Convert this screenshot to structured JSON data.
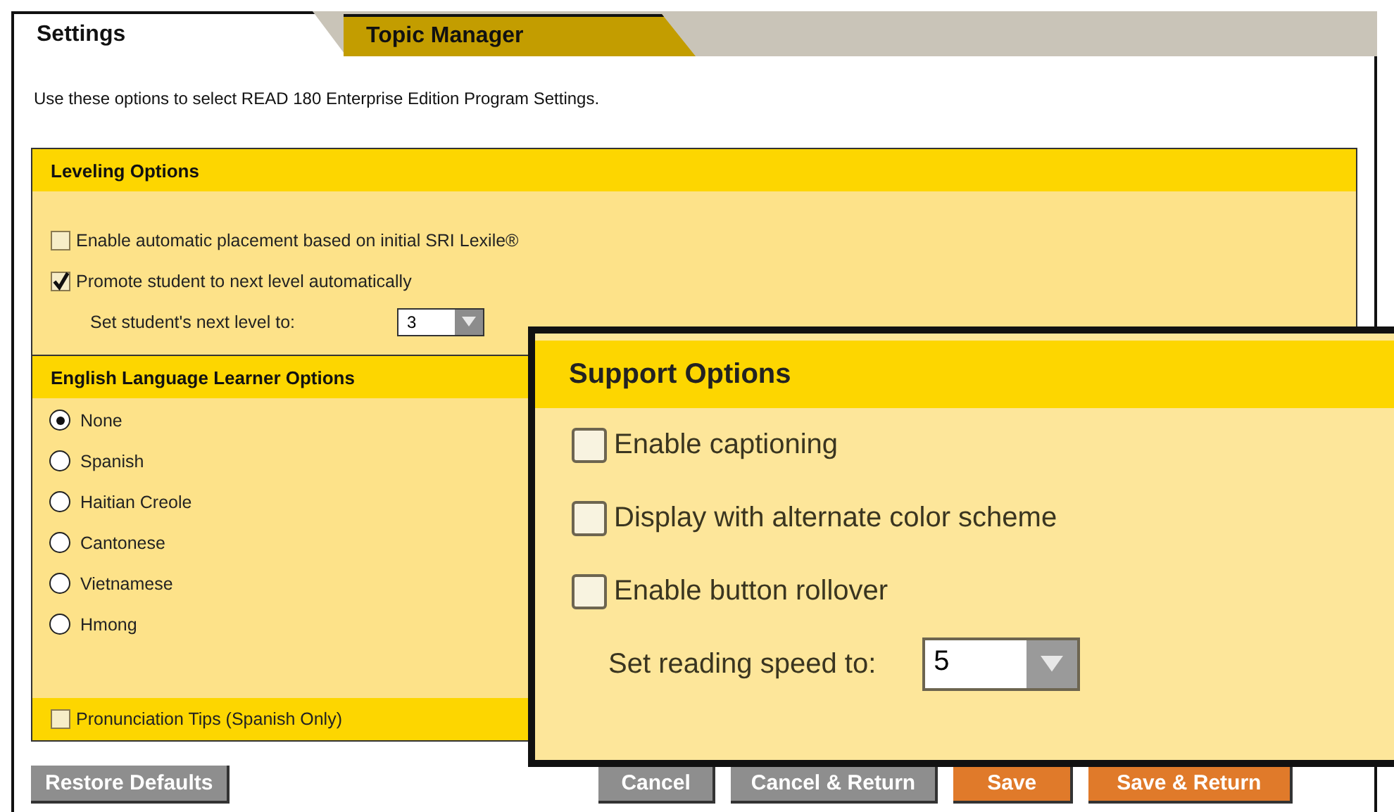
{
  "tabs": [
    {
      "label": "Settings",
      "selected": true
    },
    {
      "label": "Topic Manager",
      "selected": false
    }
  ],
  "description": "Use these options to select READ 180 Enterprise Edition Program Settings.",
  "leveling_options": {
    "title": "Leveling Options",
    "checkboxes": [
      {
        "label": "Enable automatic placement based on initial SRI Lexile®",
        "checked": false
      },
      {
        "label": "Promote student to next level automatically",
        "checked": true
      }
    ],
    "next_level": {
      "label": "Set student's next level to:",
      "value": "3"
    }
  },
  "ell_options": {
    "title": "English Language Learner Options",
    "languages": [
      {
        "label": "None",
        "selected": true
      },
      {
        "label": "Spanish",
        "selected": false
      },
      {
        "label": "Haitian Creole",
        "selected": false
      },
      {
        "label": "Cantonese",
        "selected": false
      },
      {
        "label": "Vietnamese",
        "selected": false
      },
      {
        "label": "Hmong",
        "selected": false
      }
    ],
    "pronunciation_tips": {
      "label": "Pronunciation Tips (Spanish Only)",
      "checked": false
    }
  },
  "restore_button": "Restore Defaults",
  "action_buttons": [
    {
      "label": "Cancel",
      "kind": "secondary"
    },
    {
      "label": "Cancel & Return",
      "kind": "secondary"
    },
    {
      "label": "Save",
      "kind": "primary"
    },
    {
      "label": "Save & Return",
      "kind": "primary"
    }
  ],
  "support_options": {
    "title": "Support Options",
    "checkboxes": [
      {
        "label": "Enable captioning",
        "checked": false
      },
      {
        "label": "Display with alternate color scheme",
        "checked": false
      },
      {
        "label": "Enable button rollover",
        "checked": false
      }
    ],
    "reading_speed": {
      "label": "Set reading speed to:",
      "value": "5"
    }
  }
}
